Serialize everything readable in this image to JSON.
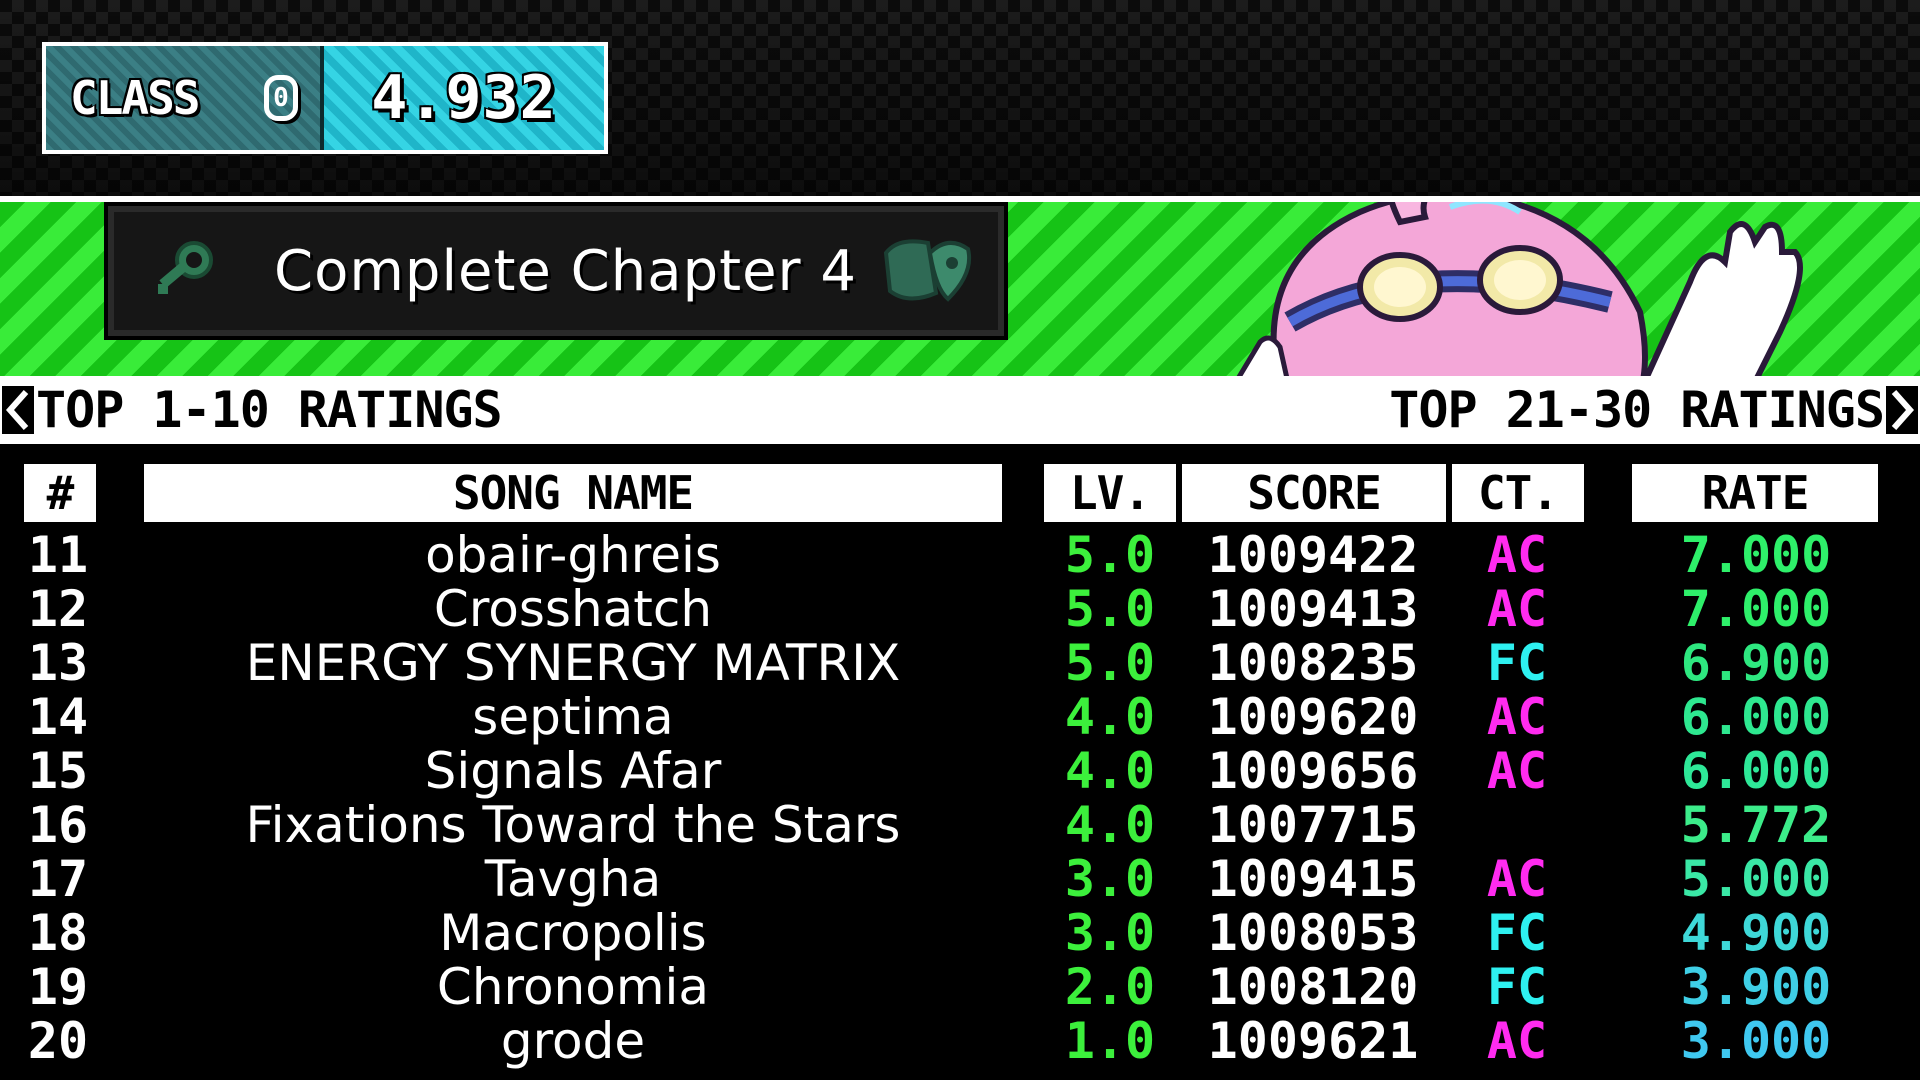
{
  "player_class": {
    "label": "CLASS",
    "icon": "class-zero-icon",
    "icon_glyph": "0",
    "value": "4.932"
  },
  "goal": {
    "icon": "key-icon",
    "text": "Complete Chapter 4",
    "badge_icon": "chapter-badge-icon"
  },
  "nav": {
    "prev_label": "TOP 1-10 RATINGS",
    "next_label": "TOP 21-30 RATINGS",
    "prev_icon": "chevron-left-icon",
    "next_icon": "chevron-right-icon"
  },
  "table": {
    "headers": {
      "num": "#",
      "song": "SONG NAME",
      "lv": "LV.",
      "score": "SCORE",
      "ct": "CT.",
      "rate": "RATE"
    },
    "rows": [
      {
        "num": "11",
        "song": "obair-ghreis",
        "lv": "5.0",
        "score": "1009422",
        "ct": "AC",
        "rate": "7.000"
      },
      {
        "num": "12",
        "song": "Crosshatch",
        "lv": "5.0",
        "score": "1009413",
        "ct": "AC",
        "rate": "7.000"
      },
      {
        "num": "13",
        "song": "ENERGY SYNERGY MATRIX",
        "lv": "5.0",
        "score": "1008235",
        "ct": "FC",
        "rate": "6.900"
      },
      {
        "num": "14",
        "song": "septima",
        "lv": "4.0",
        "score": "1009620",
        "ct": "AC",
        "rate": "6.000"
      },
      {
        "num": "15",
        "song": "Signals Afar",
        "lv": "4.0",
        "score": "1009656",
        "ct": "AC",
        "rate": "6.000"
      },
      {
        "num": "16",
        "song": "Fixations Toward the Stars",
        "lv": "4.0",
        "score": "1007715",
        "ct": "",
        "rate": "5.772"
      },
      {
        "num": "17",
        "song": "Tavgha",
        "lv": "3.0",
        "score": "1009415",
        "ct": "AC",
        "rate": "5.000"
      },
      {
        "num": "18",
        "song": "Macropolis",
        "lv": "3.0",
        "score": "1008053",
        "ct": "FC",
        "rate": "4.900"
      },
      {
        "num": "19",
        "song": "Chronomia",
        "lv": "2.0",
        "score": "1008120",
        "ct": "FC",
        "rate": "3.900"
      },
      {
        "num": "20",
        "song": "grode",
        "lv": "1.0",
        "score": "1009621",
        "ct": "AC",
        "rate": "3.000"
      }
    ]
  },
  "colors": {
    "banner_green": "#27d927",
    "lv_green": "#3cf03c",
    "ac_magenta": "#ff2bf0",
    "fc_cyan": "#2ef0f0",
    "rate_gradient_top": "#2ef06a",
    "rate_gradient_bottom": "#3fc8f0"
  }
}
